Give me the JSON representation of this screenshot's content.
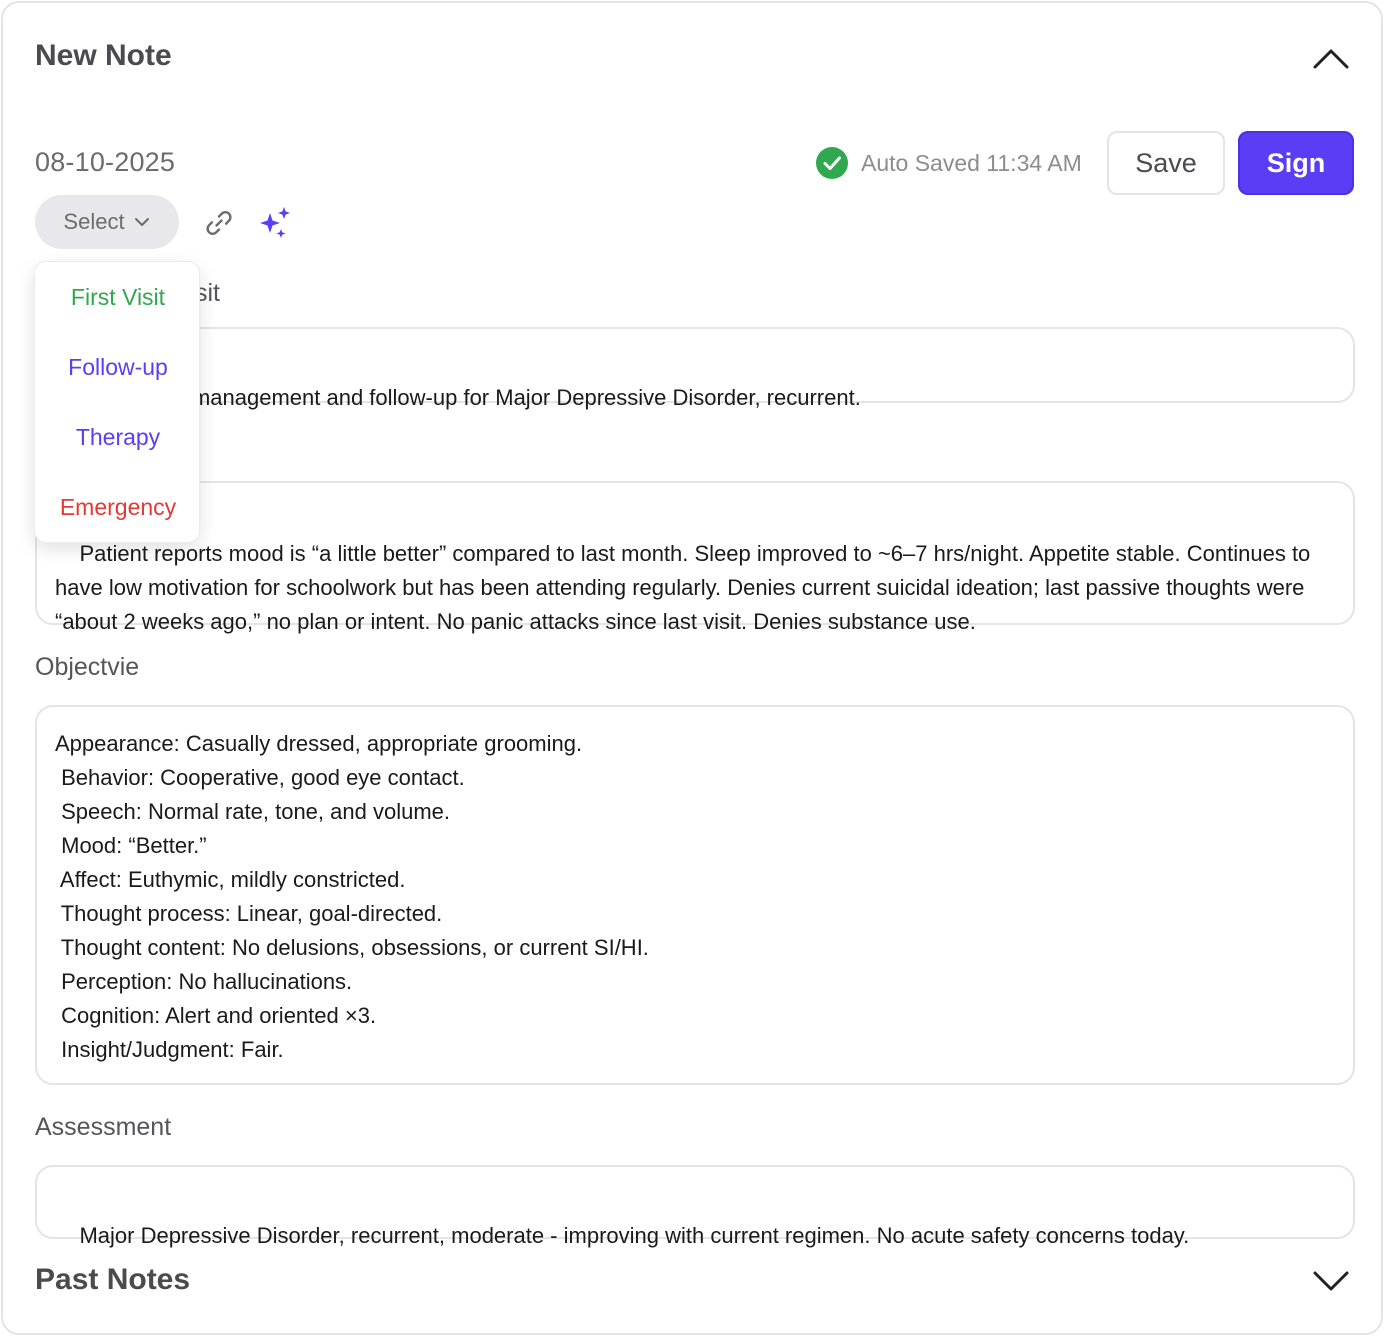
{
  "header": {
    "title": "New Note"
  },
  "note": {
    "date": "08-10-2025",
    "autosave_text": "Auto Saved 11:34 AM",
    "save_label": "Save",
    "sign_label": "Sign",
    "select_label": "Select"
  },
  "dropdown": {
    "options": [
      {
        "label": "First Visit",
        "color": "#2fa84f"
      },
      {
        "label": "Follow-up",
        "color": "#5b3df5"
      },
      {
        "label": "Therapy",
        "color": "#5b3df5"
      },
      {
        "label": "Emergency",
        "color": "#e53935"
      }
    ]
  },
  "sections": {
    "visit_label_partial": "sit",
    "visit_text": "Medication management and follow-up for Major Depressive Disorder, recurrent.",
    "subjective_text": "Patient reports mood is “a little better” compared to last month. Sleep improved to ~6–7 hrs/night. Appetite stable. Continues to have low motivation for schoolwork but has been attending regularly. Denies current suicidal ideation; last passive thoughts were “about 2 weeks ago,” no plan or intent. No panic attacks since last visit. Denies substance use.",
    "objective_label": "Objectvie",
    "objective_lines": [
      "Appearance: Casually dressed, appropriate grooming.",
      " Behavior: Cooperative, good eye contact.",
      " Speech: Normal rate, tone, and volume.",
      " Mood: “Better.”",
      " Affect: Euthymic, mildly constricted.",
      " Thought process: Linear, goal-directed.",
      " Thought content: No delusions, obsessions, or current SI/HI.",
      " Perception: No hallucinations.",
      " Cognition: Alert and oriented ×3.",
      " Insight/Judgment: Fair."
    ],
    "assessment_label": "Assessment",
    "assessment_text": "Major Depressive Disorder, recurrent, moderate - improving with current regimen. No acute safety concerns today."
  },
  "past_notes": {
    "title": "Past Notes"
  },
  "colors": {
    "accent": "#5b3df5",
    "success": "#2fa84f",
    "danger": "#e53935",
    "border": "#e4e4e7"
  },
  "icons": [
    "chevron-up-icon",
    "check-circle-icon",
    "chevron-down-icon",
    "paperclip-icon",
    "sparkles-icon"
  ]
}
